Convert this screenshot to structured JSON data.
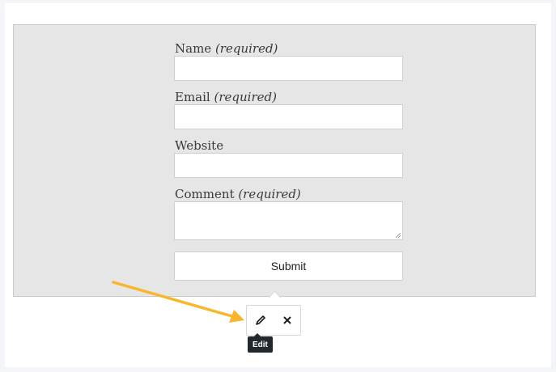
{
  "form": {
    "fields": [
      {
        "label": "Name",
        "qualifier": "(required)",
        "value": ""
      },
      {
        "label": "Email",
        "qualifier": "(required)",
        "value": ""
      },
      {
        "label": "Website",
        "qualifier": "",
        "value": ""
      },
      {
        "label": "Comment",
        "qualifier": "(required)",
        "value": ""
      }
    ],
    "submit_label": "Submit"
  },
  "block_toolbar": {
    "edit_icon": "pencil-icon",
    "remove_icon": "close-icon",
    "tooltip": "Edit"
  },
  "annotation": {
    "arrow_color": "#f8b62d"
  },
  "colors": {
    "block_background": "#e6e6e6",
    "page_background": "#f3f5f8"
  }
}
